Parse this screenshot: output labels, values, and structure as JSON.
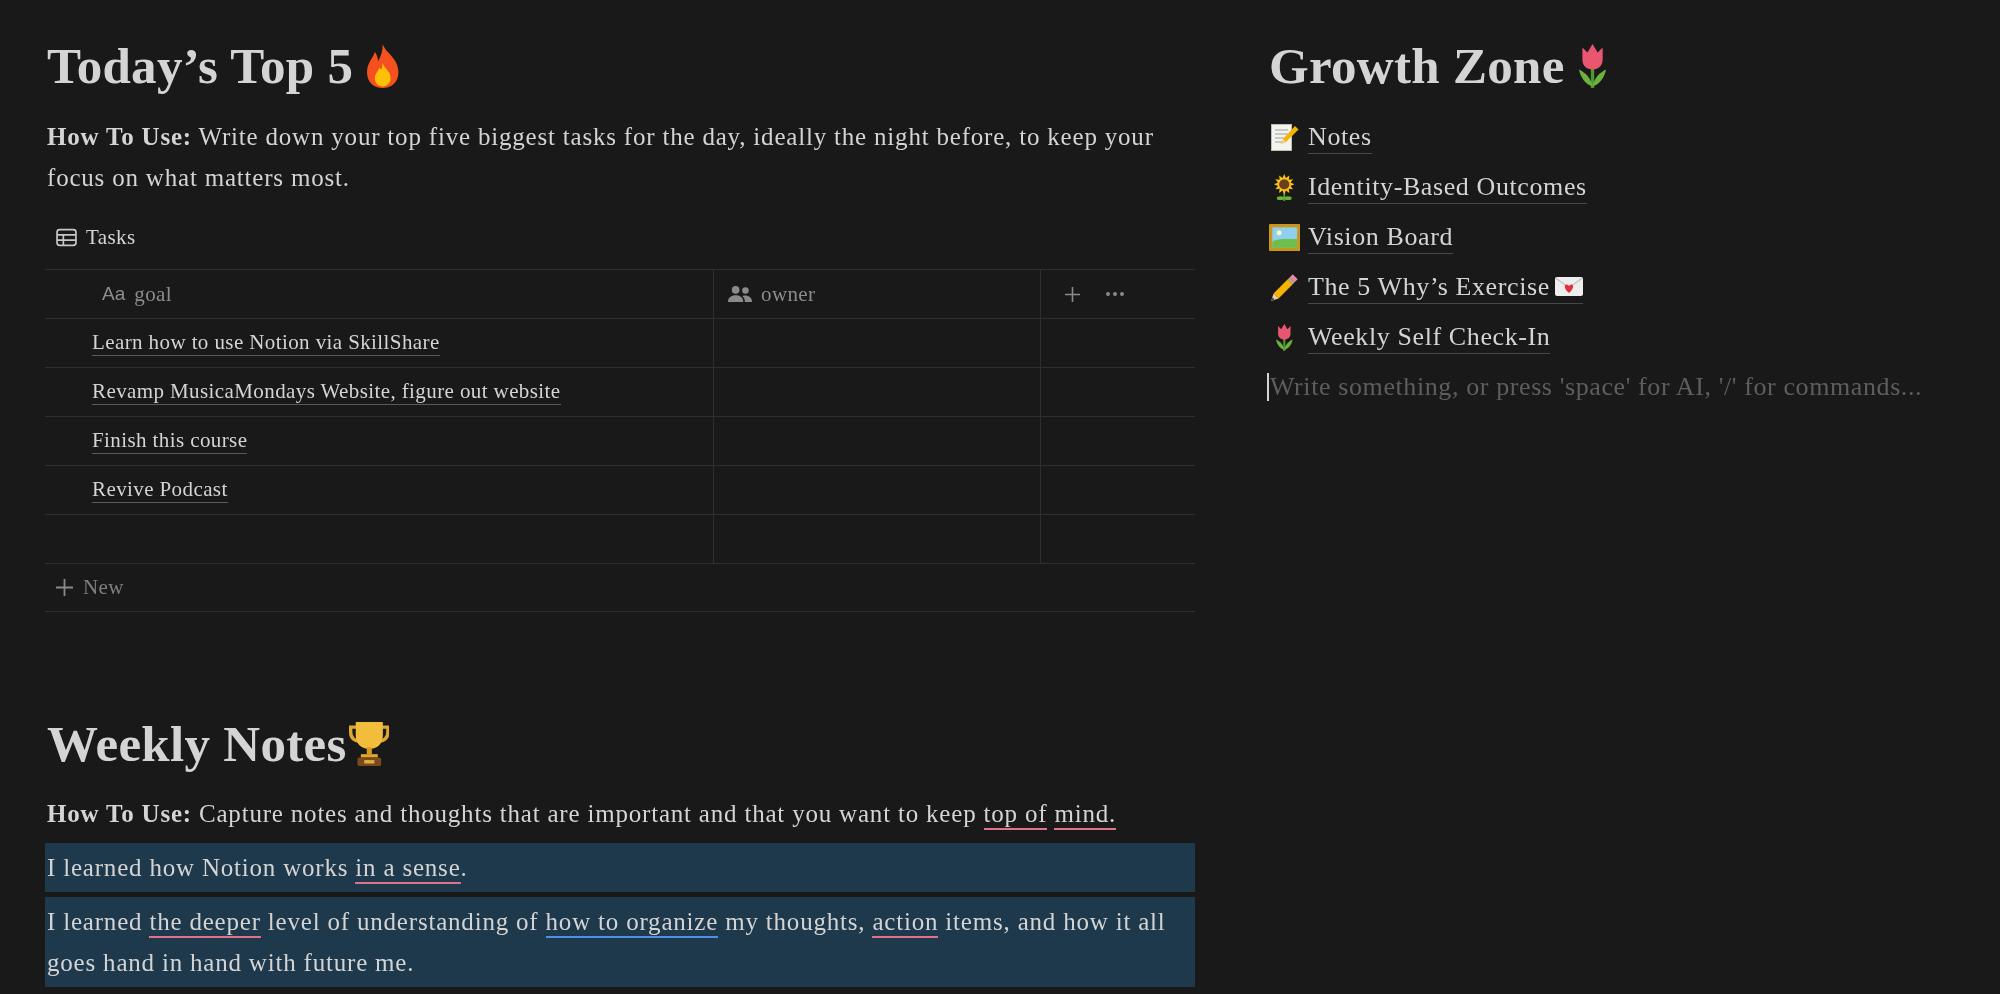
{
  "today": {
    "heading": "Today’s Top 5",
    "intro": "**How To Use:** Write down your top five biggest tasks for the day, ideally the night before, to keep your focus on what matters most.",
    "database": {
      "view": "Tasks",
      "columns": [
        {
          "kind": "title",
          "type_glyph": "Aa",
          "label": "goal"
        },
        {
          "kind": "person",
          "label": "owner"
        }
      ],
      "rows": [
        {
          "goal": "Learn how to use Notion via SkillShare"
        },
        {
          "goal": "Revamp MusicaMondays Website, figure out website"
        },
        {
          "goal": "Finish this course"
        },
        {
          "goal": "Revive Podcast"
        },
        {}
      ],
      "new_row": "New"
    }
  },
  "weekly_notes": {
    "heading": "Weekly Notes",
    "blocks": [
      {
        "highlighted": false,
        "segments": [
          {
            "text": "**How To Use:** Capture notes and thoughts that are important and that you want to keep "
          },
          {
            "text": "top of",
            "color": "#e0728c",
            "space_after": true
          },
          {
            "text": "mind.",
            "color": "#e0728c"
          }
        ]
      },
      {
        "highlighted": true,
        "segments": [
          {
            "text": "I learned how Notion works "
          },
          {
            "text": "in a sense",
            "color": "#e0728c"
          },
          {
            "text": "."
          }
        ]
      },
      {
        "highlighted": true,
        "segments": [
          {
            "text": "I learned "
          },
          {
            "text": "the deeper",
            "color": "#e0728c"
          },
          {
            "text": " level of understanding of "
          },
          {
            "text": "how to organize",
            "color": "#4f8fe6"
          },
          {
            "text": " my thoughts, "
          },
          {
            "text": "action",
            "color": "#e0728c"
          },
          {
            "text": " items, and how it all goes hand in hand with future me."
          }
        ]
      }
    ]
  },
  "growth_zone": {
    "heading": "Growth Zone",
    "links": [
      {
        "title": "Notes"
      },
      {
        "title": "Identity-Based Outcomes"
      },
      {
        "title": "Vision Board"
      },
      {
        "title": "The 5 Why’s Exercise"
      },
      {
        "title": "Weekly Self Check-In"
      }
    ],
    "placeholder": "Write something, or press 'space' for AI, '/' for commands..."
  }
}
